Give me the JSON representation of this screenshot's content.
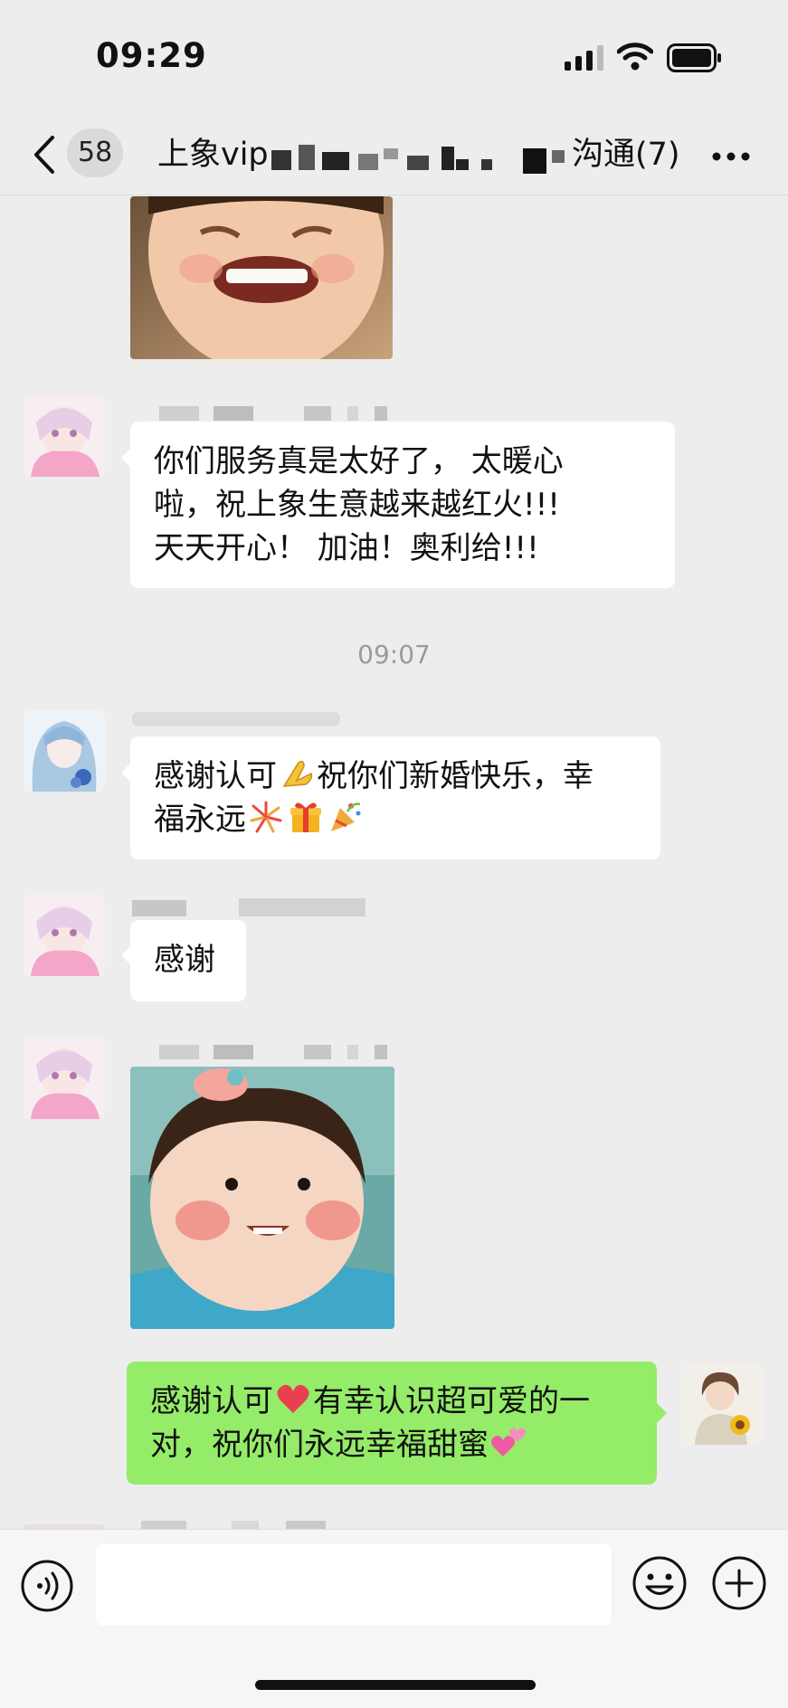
{
  "status_bar": {
    "time": "09:29",
    "icons": [
      "signal-icon",
      "wifi-icon",
      "battery-icon"
    ]
  },
  "nav": {
    "back_icon": "chevron-left-icon",
    "unread_count": "58",
    "title_prefix": "上象vip",
    "title_suffix": "沟通(7)",
    "more_icon": "more-icon"
  },
  "messages": [
    {
      "type": "image",
      "side": "left",
      "image": "child-grinning-photo"
    },
    {
      "type": "text",
      "side": "left",
      "avatar": "anime-pink-hoodie-avatar",
      "lines": [
        "你们服务真是太好了，  太暖心",
        "啦，祝上象生意越来越红火!!!",
        "天天开心！ 加油！奥利给!!!"
      ]
    },
    {
      "type": "timestamp",
      "text": "09:07"
    },
    {
      "type": "text",
      "side": "left",
      "avatar": "anime-blue-hair-avatar",
      "line1": "感谢认可",
      "line1b": "祝你们新婚快乐，幸",
      "line2": "福永远",
      "emojis": [
        "folded-hands-emoji",
        "fireworks-emoji",
        "gift-emoji",
        "party-popper-emoji"
      ]
    },
    {
      "type": "text",
      "side": "left",
      "avatar": "anime-pink-hoodie-avatar",
      "text": "感谢"
    },
    {
      "type": "image",
      "side": "left",
      "avatar": "anime-pink-hoodie-avatar",
      "image": "child-smiling-photo"
    },
    {
      "type": "text",
      "side": "right",
      "avatar": "woman-with-sunflower-avatar",
      "line1a": "感谢认可",
      "line1b": "有幸认识超可爱的一",
      "line2": "对，祝你们永远幸福甜蜜",
      "emojis": [
        "red-heart-emoji",
        "two-hearts-emoji"
      ]
    }
  ],
  "input_bar": {
    "voice_icon": "voice-icon",
    "input_value": "",
    "emoji_icon": "smiley-icon",
    "plus_icon": "plus-circle-icon"
  },
  "colors": {
    "background": "#ededed",
    "my_bubble": "#95ec69",
    "other_bubble": "#ffffff",
    "timestamp": "#9b9b9b"
  }
}
